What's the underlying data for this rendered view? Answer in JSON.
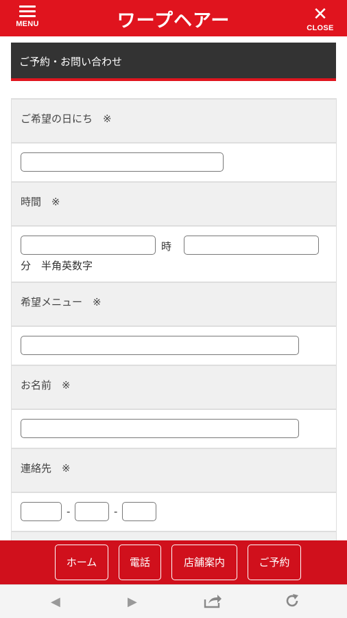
{
  "header": {
    "menu_label": "MENU",
    "logo_text": "ワープヘアー",
    "close_label": "CLOSE"
  },
  "page": {
    "title": "ご予約・お問い合わせ"
  },
  "form": {
    "date_label": "ご希望の日にち　※",
    "time_label": "時間　※",
    "hour_suffix": "時",
    "minute_suffix": "分　半角英数字",
    "menu_label": "希望メニュー　※",
    "name_label": "お名前　※",
    "contact_label": "連絡先　※",
    "phone_separator": "-"
  },
  "bottom_nav": {
    "home": "ホーム",
    "phone": "電話",
    "store_info": "店舗案内",
    "reserve": "ご予約"
  },
  "browser_bar": {
    "back_icon": "back-arrow-icon",
    "forward_icon": "forward-arrow-icon",
    "share_icon": "share-icon",
    "reload_icon": "reload-icon"
  },
  "colors": {
    "brand_red": "#e0141e",
    "title_bar_bg": "#333333",
    "label_bg": "#f0f0f0"
  }
}
